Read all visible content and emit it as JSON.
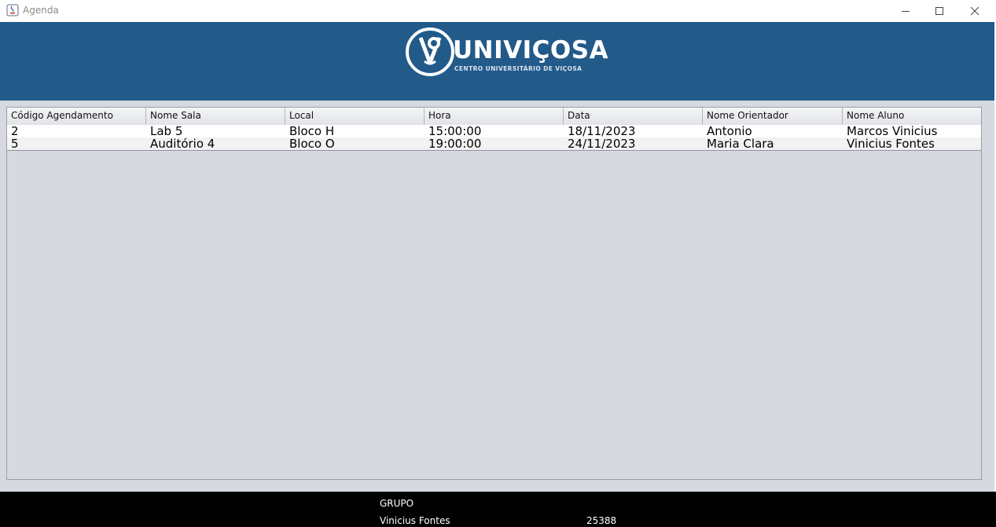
{
  "window": {
    "title": "Agenda",
    "controls": {
      "minimize": "minimize-icon",
      "maximize": "maximize-icon",
      "close": "close-icon"
    }
  },
  "banner": {
    "background": "#225a8a",
    "logo_text": "UNIVIÇOSA",
    "logo_subtitle": "CENTRO UNIVERSITÁRIO DE VIÇOSA"
  },
  "table": {
    "columns": [
      "Código Agendamento",
      "Nome Sala",
      "Local",
      "Hora",
      "Data",
      "Nome Orientador",
      "Nome Aluno"
    ],
    "rows": [
      [
        "2",
        "Lab 5",
        "Bloco H",
        "15:00:00",
        "18/11/2023",
        "Antonio",
        "Marcos Vinicius"
      ],
      [
        "5",
        "Auditório 4",
        "Bloco O",
        "19:00:00",
        "24/11/2023",
        "Maria Clara",
        "Vinicius Fontes"
      ]
    ]
  },
  "footer": {
    "group_label": "GRUPO",
    "members": [
      {
        "name": "Vinicius Fontes",
        "id": "25388"
      }
    ]
  }
}
